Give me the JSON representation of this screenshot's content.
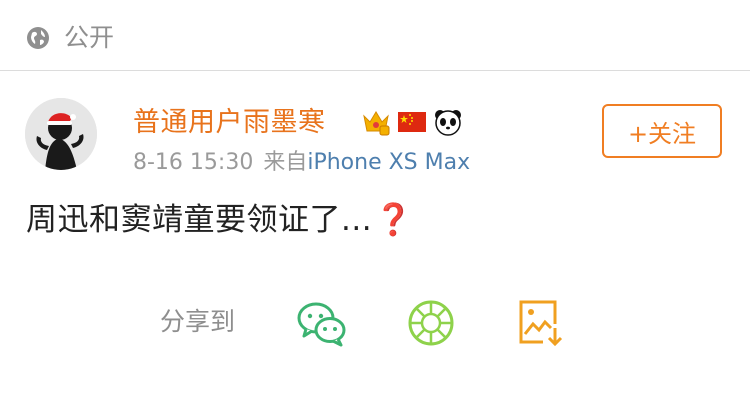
{
  "visibility": {
    "icon": "globe-icon",
    "label": "公开"
  },
  "post": {
    "username": "普通用户雨墨寒",
    "badges": [
      "crown-badge-icon",
      "china-flag-icon",
      "panda-icon"
    ],
    "time": "8-16 15:30",
    "source_prefix": "来自",
    "source_device": "iPhone XS Max",
    "follow_label": "+关注",
    "text": "周迅和窦靖童要领证了...",
    "emoji": "❓"
  },
  "share": {
    "label": "分享到",
    "targets": [
      "wechat-icon",
      "moments-icon",
      "save-image-icon"
    ]
  },
  "colors": {
    "username": "#e8731c",
    "follow": "#f07e23",
    "device": "#4e7fae",
    "wechat": "#3cb371",
    "moments": "#8ed24b",
    "save": "#f0a020"
  }
}
